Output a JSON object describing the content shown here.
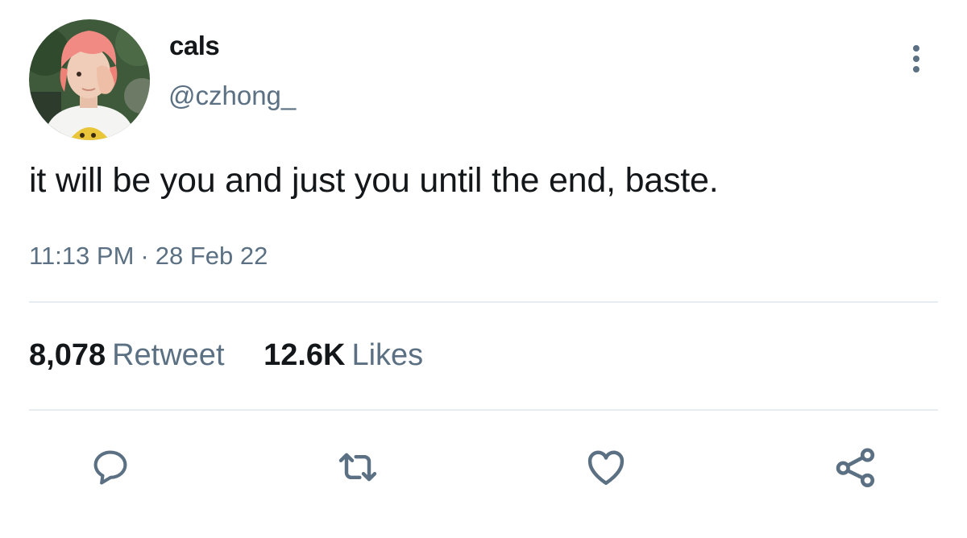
{
  "tweet": {
    "display_name": "cals",
    "handle": "@czhong_",
    "text": "it will be you and just you until the end, baste.",
    "time": "11:13 PM",
    "separator": "·",
    "date": "28 Feb 22"
  },
  "stats": {
    "retweets_count": "8,078",
    "retweets_label": "Retweet",
    "likes_count": "12.6K",
    "likes_label": "Likes"
  },
  "actions": [
    {
      "name": "reply",
      "icon": "reply-icon"
    },
    {
      "name": "retweet",
      "icon": "retweet-icon"
    },
    {
      "name": "like",
      "icon": "heart-icon"
    },
    {
      "name": "share",
      "icon": "share-icon"
    }
  ],
  "colors": {
    "text_primary": "#14171a",
    "text_secondary": "#5b7083",
    "divider": "#e6ecf0"
  }
}
